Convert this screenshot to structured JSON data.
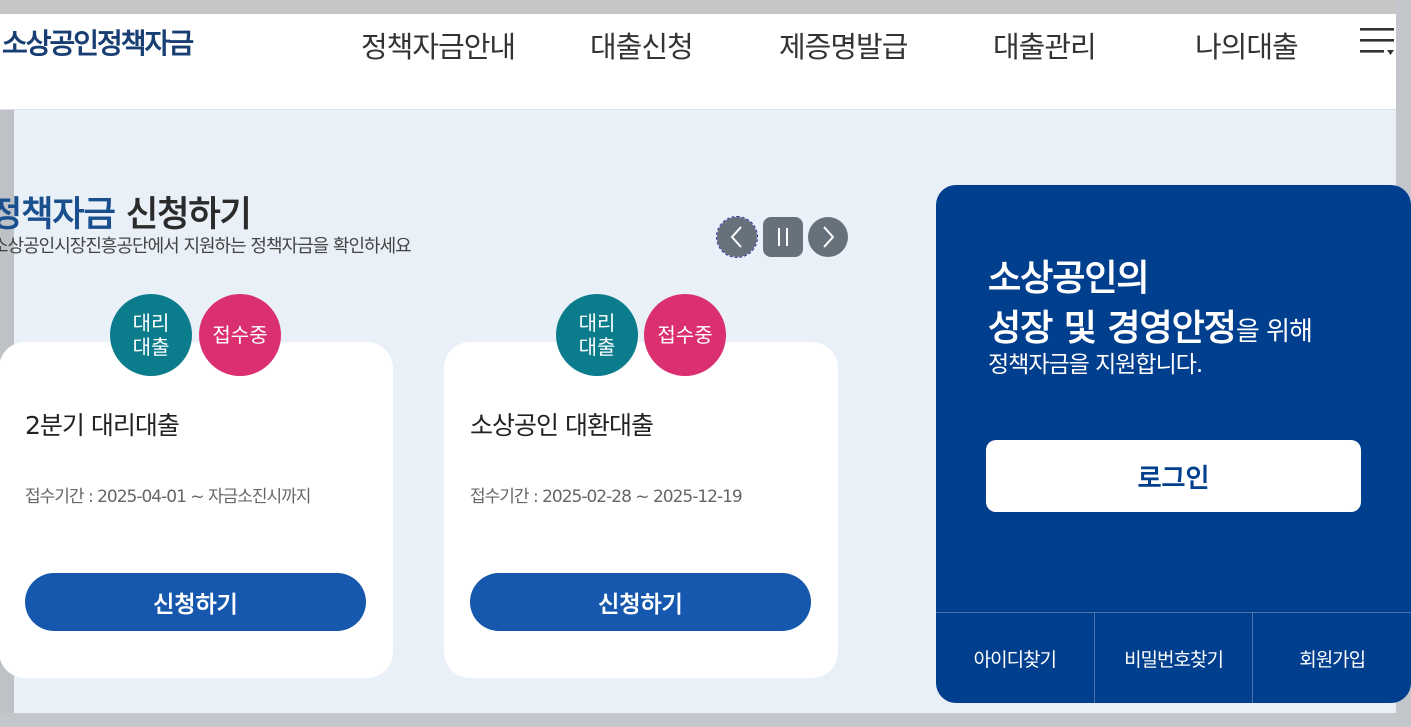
{
  "header": {
    "logo": "소상공인정책자금",
    "nav": [
      "정책자금안내",
      "대출신청",
      "제증명발급",
      "대출관리",
      "나의대출"
    ]
  },
  "section": {
    "title_accent": "정책자금",
    "title_rest": " 신청하기",
    "subtitle": "소상공인시장진흥공단에서 지원하는 정책자금을 확인하세요"
  },
  "cards": [
    {
      "type_badge": "대리\n대출",
      "status_badge": "접수중",
      "title": "2분기 대리대출",
      "period": "접수기간 : 2025-04-01 ~ 자금소진시까지",
      "button": "신청하기"
    },
    {
      "type_badge": "대리\n대출",
      "status_badge": "접수중",
      "title": "소상공인 대환대출",
      "period": "접수기간 : 2025-02-28 ~ 2025-12-19",
      "button": "신청하기"
    }
  ],
  "login_panel": {
    "line1": "소상공인의",
    "line2_bold": "성장 및 경영안정",
    "line2_rest": "을 위해",
    "line3": "정책자금을 지원합니다.",
    "login_button": "로그인",
    "links": [
      "아이디찾기",
      "비밀번호찾기",
      "회원가입"
    ]
  },
  "colors": {
    "brand_navy": "#003e8e",
    "button_blue": "#1558ad",
    "badge_teal": "#0b7c8c",
    "badge_pink": "#da2f70",
    "title_blue": "#1a4f8e"
  },
  "icons": {
    "prev": "chevron-left-icon",
    "pause": "pause-icon",
    "next": "chevron-right-icon",
    "menu": "hamburger-menu-icon"
  }
}
